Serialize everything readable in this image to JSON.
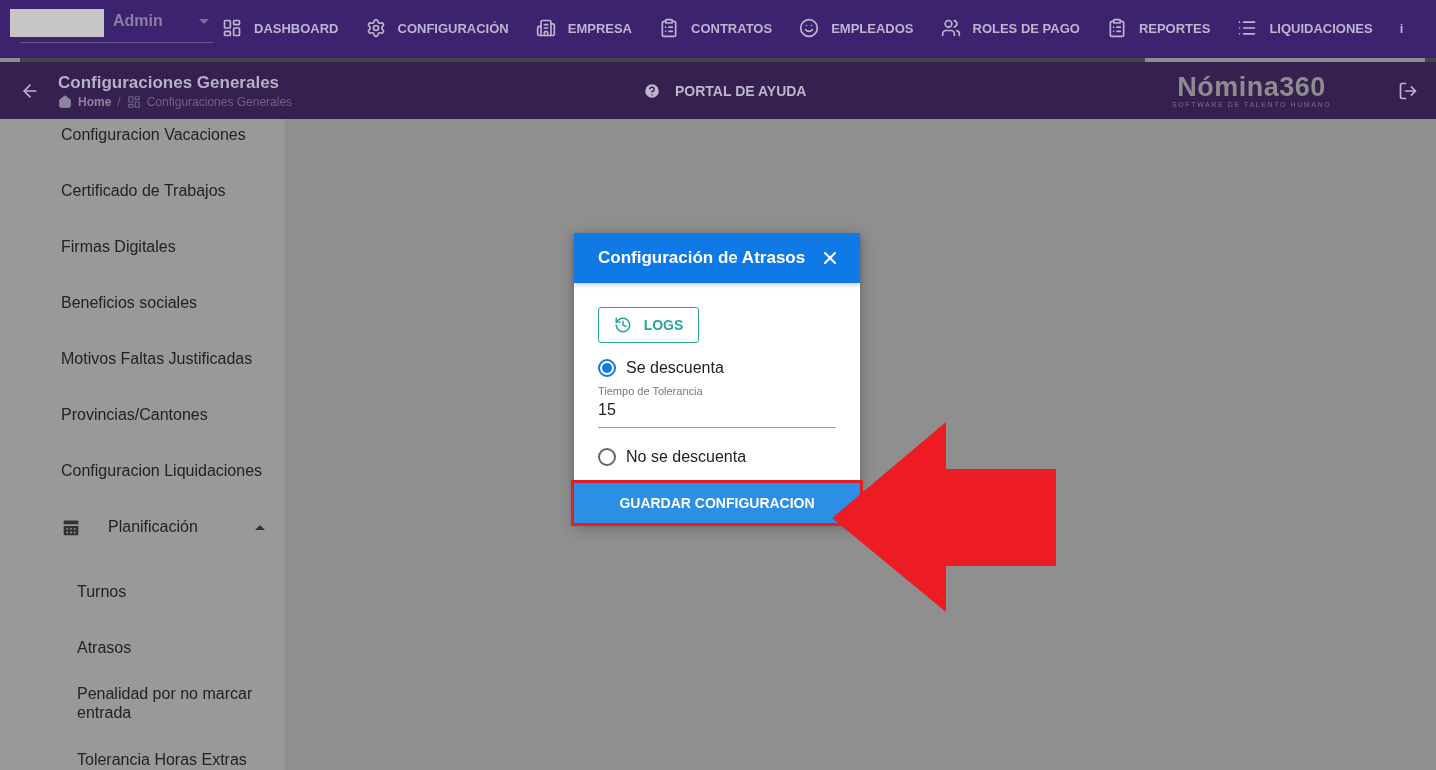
{
  "user": {
    "name": "Admin"
  },
  "nav": [
    {
      "label": "DASHBOARD"
    },
    {
      "label": "CONFIGURACIÓN"
    },
    {
      "label": "EMPRESA"
    },
    {
      "label": "CONTRATOS"
    },
    {
      "label": "EMPLEADOS"
    },
    {
      "label": "ROLES DE PAGO"
    },
    {
      "label": "REPORTES"
    },
    {
      "label": "LIQUIDACIONES"
    }
  ],
  "nav_cut": "i",
  "header": {
    "title": "Configuraciones Generales",
    "breadcrumb": [
      "Home",
      "Configuraciones Generales"
    ],
    "breadcrumb_separator": "/",
    "help": "PORTAL DE AYUDA",
    "logo": "Nómina360",
    "logo_tagline": "SOFTWARE DE TALENTO HUMANO"
  },
  "sidebar": {
    "items": [
      {
        "label": "Configuracion Vacaciones"
      },
      {
        "label": "Certificado de Trabajos"
      },
      {
        "label": "Firmas Digitales"
      },
      {
        "label": "Beneficios sociales"
      },
      {
        "label": "Motivos Faltas Justificadas"
      },
      {
        "label": "Provincias/Cantones"
      },
      {
        "label": "Configuracion Liquidaciones"
      },
      {
        "label": "Planificación",
        "expanded": true,
        "children": [
          {
            "label": "Turnos"
          },
          {
            "label": "Atrasos"
          },
          {
            "label": "Penalidad por no marcar entrada"
          },
          {
            "label": "Tolerancia Horas Extras"
          }
        ]
      }
    ]
  },
  "dialog": {
    "title": "Configuración de Atrasos",
    "logs_button": "LOGS",
    "options": [
      {
        "label": "Se descuenta",
        "selected": true,
        "field": {
          "label": "Tiempo de Tolerancia",
          "value": "15"
        }
      },
      {
        "label": "No se descuenta",
        "selected": false
      }
    ],
    "save_button": "GUARDAR CONFIGURACION"
  }
}
